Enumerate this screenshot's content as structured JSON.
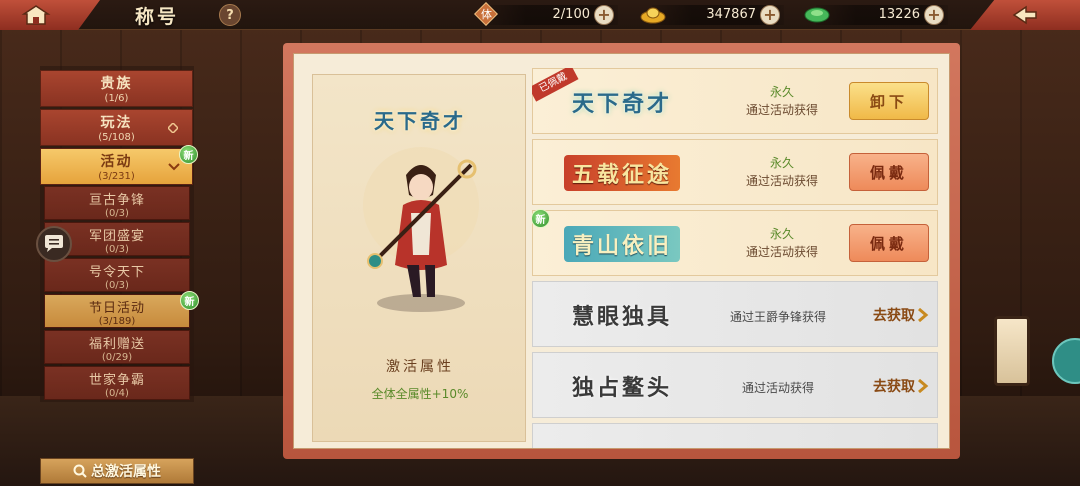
{
  "header": {
    "title": "称号",
    "help_label": "?",
    "stamina": {
      "icon_label": "体",
      "value": "2/100"
    },
    "gold": {
      "value": "347867"
    },
    "jade": {
      "value": "13226"
    },
    "plus_label": "+"
  },
  "sidebar": {
    "categories": [
      {
        "name": "贵族",
        "count": "(1/6)"
      },
      {
        "name": "玩法",
        "count": "(5/108)"
      },
      {
        "name": "活动",
        "count": "(3/231)",
        "badge": "新"
      }
    ],
    "subitems": [
      {
        "name": "亘古争锋",
        "count": "(0/3)"
      },
      {
        "name": "军团盛宴",
        "count": "(0/3)"
      },
      {
        "name": "号令天下",
        "count": "(0/3)"
      },
      {
        "name": "节日活动",
        "count": "(3/189)",
        "badge": "新"
      },
      {
        "name": "福利赠送",
        "count": "(0/29)"
      },
      {
        "name": "世家争霸",
        "count": "(0/4)"
      }
    ],
    "total_attr_label": "总激活属性"
  },
  "preview": {
    "title": "天下奇才",
    "attr_label": "激活属性",
    "attr_value": "全体全属性+10%"
  },
  "titles": [
    {
      "name": "天下奇才",
      "duration": "永久",
      "source": "通过活动获得",
      "action": "卸下",
      "tag": "已佩戴"
    },
    {
      "name": "五载征途",
      "duration": "永久",
      "source": "通过活动获得",
      "action": "佩戴"
    },
    {
      "name": "青山依旧",
      "duration": "永久",
      "source": "通过活动获得",
      "action": "佩戴",
      "badge": "新"
    },
    {
      "name": "慧眼独具",
      "source": "通过王爵争锋获得",
      "action": "去获取"
    },
    {
      "name": "独占鳌头",
      "source": "通过活动获得",
      "action": "去获取"
    }
  ],
  "colors": {
    "accent_red": "#b8553d",
    "active_gold": "#e6a33c",
    "green_text": "#5a8a2a"
  }
}
